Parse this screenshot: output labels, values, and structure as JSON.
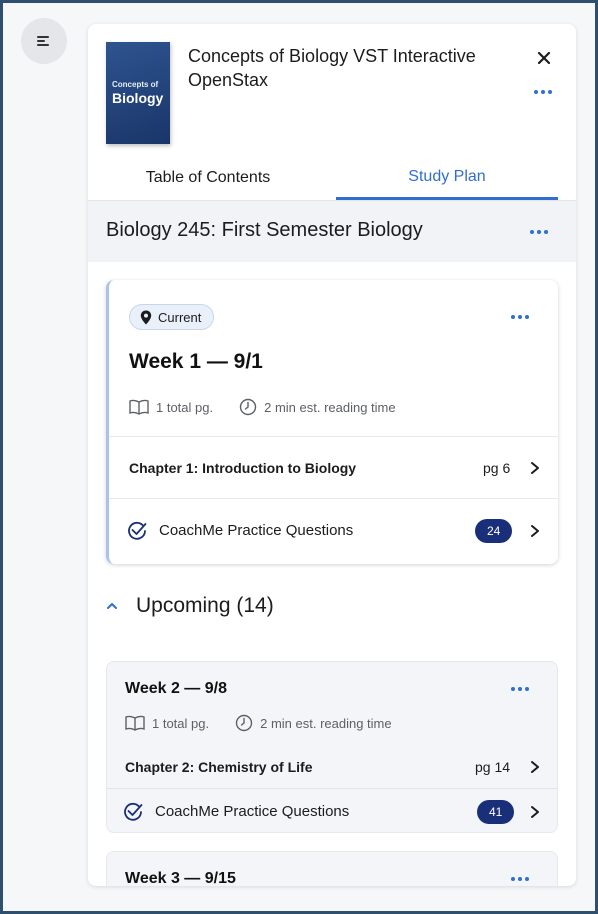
{
  "book": {
    "cover_subtitle": "Concepts of",
    "cover_title": "Biology",
    "title": "Concepts of Biology VST Interactive OpenStax"
  },
  "tabs": [
    {
      "label": "Table of Contents",
      "active": false
    },
    {
      "label": "Study Plan",
      "active": true
    }
  ],
  "course": {
    "title": "Biology 245: First Semester Biology"
  },
  "current": {
    "badge": "Current",
    "week_title": "Week 1 — 9/1",
    "total_pages": "1 total pg.",
    "reading_time": "2 min est. reading time",
    "chapter": "Chapter 1: Introduction to Biology",
    "chapter_page": "pg 6",
    "practice_label": "CoachMe Practice Questions",
    "practice_count": "24"
  },
  "upcoming": {
    "label": "Upcoming (14)",
    "weeks": [
      {
        "week_title": "Week 2 — 9/8",
        "total_pages": "1 total pg.",
        "reading_time": "2 min est. reading time",
        "chapter": "Chapter 2: Chemistry of Life",
        "chapter_page": "pg 14",
        "practice_label": "CoachMe Practice Questions",
        "practice_count": "41"
      },
      {
        "week_title": "Week 3 — 9/15"
      }
    ]
  },
  "colors": {
    "accent": "#2f6fd0",
    "badge_bg": "#1a2f7a",
    "frame_border": "#2f4f6f"
  }
}
